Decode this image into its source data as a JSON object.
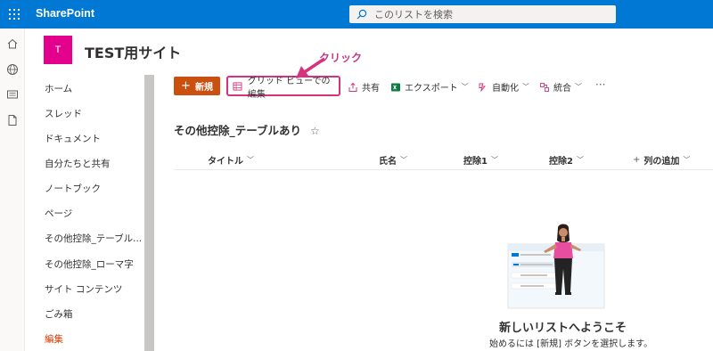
{
  "suite": {
    "brand": "SharePoint",
    "search_placeholder": "このリストを検索"
  },
  "site": {
    "logo_letter": "T",
    "title": "TEST用サイト"
  },
  "nav": {
    "items": [
      {
        "label": "ホーム"
      },
      {
        "label": "スレッド"
      },
      {
        "label": "ドキュメント"
      },
      {
        "label": "自分たちと共有"
      },
      {
        "label": "ノートブック"
      },
      {
        "label": "ページ"
      },
      {
        "label": "その他控除_テーブル..."
      },
      {
        "label": "その他控除_ローマ字"
      },
      {
        "label": "サイト コンテンツ"
      },
      {
        "label": "ごみ箱"
      },
      {
        "label": "編集"
      }
    ]
  },
  "commands": {
    "new_label": "新規",
    "grid_view_label": "グリッド ビューでの編集",
    "share_label": "共有",
    "export_label": "エクスポート",
    "automate_label": "自動化",
    "integrate_label": "統合",
    "more_label": "···"
  },
  "callout": "クリック",
  "list": {
    "title": "その他控除_テーブルあり",
    "columns": {
      "title": "タイトル",
      "name": "氏名",
      "deduction1": "控除1",
      "deduction2": "控除2",
      "add_column": "列の追加"
    }
  },
  "empty_state": {
    "heading": "新しいリストへようこそ",
    "hint": "始めるには [新規] ボタンを選択します。"
  },
  "colors": {
    "suite_bar": "#0078d4",
    "site_logo": "#e3008c",
    "new_button": "#ca5010",
    "highlight": "#d6337c"
  }
}
